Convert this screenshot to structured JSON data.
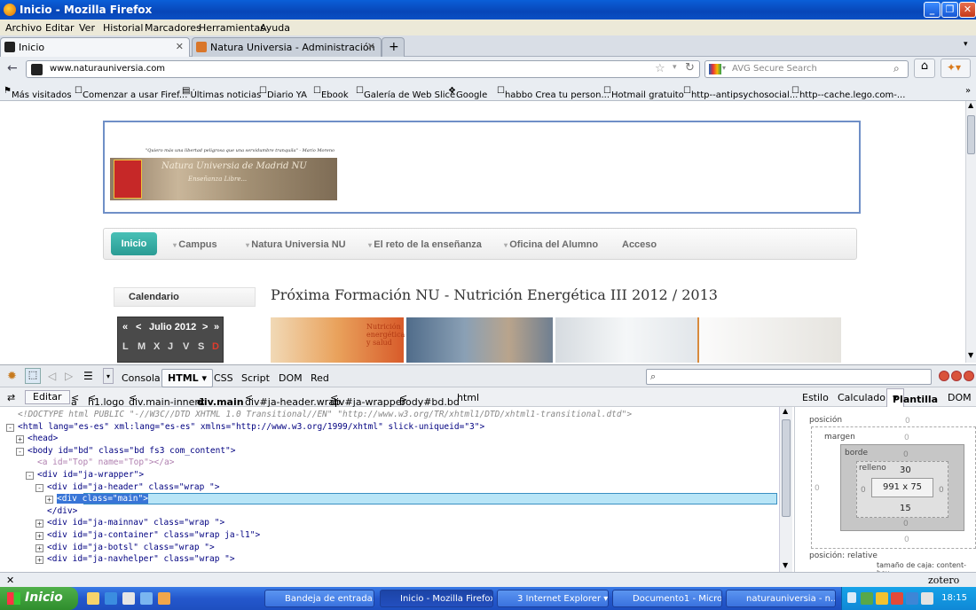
{
  "window": {
    "title": "Inicio - Mozilla Firefox"
  },
  "menu": [
    "Archivo",
    "Editar",
    "Ver",
    "Historial",
    "Marcadores",
    "Herramientas",
    "Ayuda"
  ],
  "tabs": [
    {
      "label": "Inicio"
    },
    {
      "label": "Natura Universia - Administración"
    }
  ],
  "nav": {
    "url": "www.naturauniversia.com",
    "search_placeholder": "AVG Secure Search"
  },
  "bookmarks": [
    "Más visitados",
    "Comenzar a usar Firef...",
    "Últimas noticias",
    "Diario YA",
    "Ebook",
    "Galería de Web Slice",
    "Google",
    "habbo Crea tu person...",
    "Hotmail gratuito",
    "http--antipsychosocial...",
    "http--cache.lego.com-..."
  ],
  "site": {
    "quote": "\"Quiero más una libertad peligrosa que una servidumbre tranquila\" - Mario Moreno",
    "banner_title": "Natura Universia de Madrid NU",
    "banner_sub": "Enseñanza Libre...",
    "mainnav": [
      "Inicio",
      "Campus",
      "Natura Universia NU",
      "El reto de la enseñanza",
      "Oficina del Alumno",
      "Acceso"
    ],
    "sidebar_title": "Calendario",
    "calendar": {
      "prev_year": "«",
      "prev": "<",
      "month": "Julio 2012",
      "next": ">",
      "next_year": "»",
      "days": [
        "L",
        "M",
        "X",
        "J",
        "V",
        "S",
        "D"
      ]
    },
    "article_title": "Próxima Formación NU - Nutrición Energética III 2012 / 2013",
    "img1_text": "Nutrición energética y salud"
  },
  "firebug": {
    "tabs": [
      "Consola",
      "HTML",
      "CSS",
      "Script",
      "DOM",
      "Red"
    ],
    "breadcrumb": {
      "edit": "Editar",
      "items": [
        "a",
        "h1.logo",
        "div.main-inner1",
        "div.main",
        "div#ja-header.wrap",
        "div#ja-wrapper",
        "body#bd.bd",
        "html"
      ]
    },
    "side_tabs": [
      "Estilo",
      "Calculado",
      "Plantilla",
      "DOM"
    ],
    "html_lines": [
      {
        "indent": 0,
        "type": "comment",
        "text": "<!DOCTYPE html PUBLIC \"-//W3C//DTD XHTML 1.0 Transitional//EN\" \"http://www.w3.org/TR/xhtml1/DTD/xhtml1-transitional.dtd\">"
      },
      {
        "indent": 0,
        "type": "open",
        "twisty": "-",
        "text": "<html lang=\"es-es\" xml:lang=\"es-es\" xmlns=\"http://www.w3.org/1999/xhtml\" slick-uniqueid=\"3\">"
      },
      {
        "indent": 1,
        "type": "open",
        "twisty": "+",
        "text": "<head>"
      },
      {
        "indent": 1,
        "type": "open",
        "twisty": "-",
        "text": "<body id=\"bd\" class=\"bd fs3 com_content\">"
      },
      {
        "indent": 2,
        "type": "faded",
        "text": "<a id=\"Top\" name=\"Top\"></a>"
      },
      {
        "indent": 2,
        "type": "open",
        "twisty": "-",
        "text": "<div id=\"ja-wrapper\">"
      },
      {
        "indent": 3,
        "type": "open",
        "twisty": "-",
        "text": "<div id=\"ja-header\" class=\"wrap \">"
      },
      {
        "indent": 4,
        "type": "selected",
        "twisty": "+",
        "text": "<div class=\"main\">"
      },
      {
        "indent": 3,
        "type": "close",
        "text": "</div>"
      },
      {
        "indent": 3,
        "type": "open",
        "twisty": "+",
        "text": "<div id=\"ja-mainnav\" class=\"wrap \">"
      },
      {
        "indent": 3,
        "type": "open",
        "twisty": "+",
        "text": "<div id=\"ja-container\" class=\"wrap ja-l1\">"
      },
      {
        "indent": 3,
        "type": "open",
        "twisty": "+",
        "text": "<div id=\"ja-botsl\" class=\"wrap \">"
      },
      {
        "indent": 3,
        "type": "open",
        "twisty": "+",
        "text": "<div id=\"ja-navhelper\" class=\"wrap \">"
      }
    ],
    "layout": {
      "position_label": "posición",
      "position_val": "0",
      "margin_label": "margen",
      "margin_val": "0",
      "border_label": "borde",
      "border_val": "0",
      "padding_label": "relleno",
      "padding_top": "30",
      "padding_bottom": "15",
      "content_size": "991 x 75",
      "side_val": "0",
      "position_type": "posición: relative",
      "box_sizing": "tamaño de caja: content-box"
    }
  },
  "statusbar": {
    "addon": "zotero"
  },
  "taskbar": {
    "start": "Inicio",
    "items": [
      {
        "label": "Bandeja de entrada..."
      },
      {
        "label": "Inicio - Mozilla Firefox"
      },
      {
        "label": "3 Internet Explorer"
      },
      {
        "label": "Documento1 - Micro..."
      },
      {
        "label": "naturauniversia - n..."
      }
    ],
    "clock": "18:15"
  }
}
